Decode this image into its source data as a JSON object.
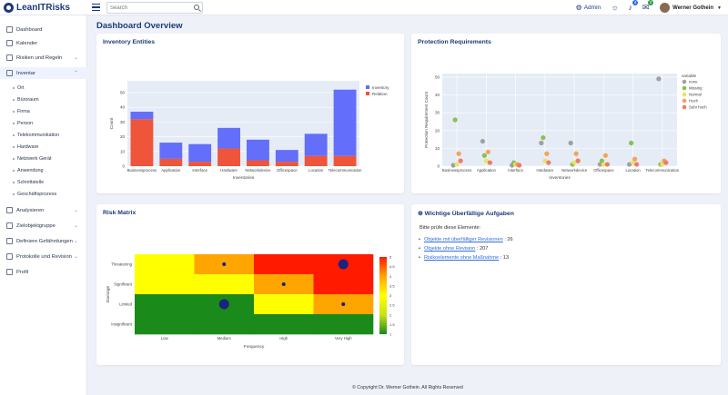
{
  "app": {
    "title": "LeanITRisks"
  },
  "search": {
    "placeholder": "Search"
  },
  "topbar": {
    "admin_label": "Admin",
    "notifications_count": "4",
    "messages_count": "2",
    "user_name": "Werner Gothein"
  },
  "sidebar": {
    "items": [
      {
        "label": "Dashboard",
        "icon": "dashboard-icon",
        "has_children": false
      },
      {
        "label": "Kalender",
        "icon": "calendar-icon",
        "has_children": false
      },
      {
        "label": "Risiken und Regeln",
        "icon": "risk-icon",
        "has_children": true
      },
      {
        "label": "Inventar",
        "icon": "inventory-icon",
        "has_children": true,
        "expanded": true
      },
      {
        "label": "Analysieren",
        "icon": "analyze-icon",
        "has_children": true
      },
      {
        "label": "Zielobjektgruppe",
        "icon": "target-group-icon",
        "has_children": true
      },
      {
        "label": "Definiere Gefährdungen",
        "icon": "threat-icon",
        "has_children": true
      },
      {
        "label": "Protokolle und Revision",
        "icon": "log-icon",
        "has_children": true
      },
      {
        "label": "Profil",
        "icon": "profile-icon",
        "has_children": false
      }
    ],
    "inventar_children": [
      "Ort",
      "Büroraum",
      "Firma",
      "Person",
      "Telekommunikation",
      "Hardware",
      "Netzwerk Gerät",
      "Anwendung",
      "Schnittstelle",
      "Geschäftsprozess"
    ]
  },
  "main": {
    "title": "Dashboard Overview"
  },
  "cards": {
    "inventory": {
      "title": "Inventory Entities"
    },
    "protection": {
      "title": "Protection Requirements"
    },
    "risk": {
      "title": "Risk Matrix"
    },
    "tasks": {
      "title": "Wichtige Überfällige Aufgaben",
      "intro": "Bitte prüfe diese Elemente:",
      "items": [
        {
          "link": "Objekte mit überfälliger Revisionen",
          "value": ": 26"
        },
        {
          "link": "Objekte ohne Revision",
          "value": ": 207"
        },
        {
          "link": "Risikoelemente ohne Maßnahme",
          "value": ": 13"
        }
      ]
    }
  },
  "chart_data": [
    {
      "type": "bar",
      "title": "",
      "xlabel": "Inventories",
      "ylabel": "Count",
      "categories": [
        "Businessprocess",
        "Application",
        "Interface",
        "Hardware",
        "Networkdevice",
        "Officespace",
        "Location",
        "Telecommunication"
      ],
      "series": [
        {
          "name": "Inventory",
          "color": "#636efa",
          "values": [
            5,
            11,
            12,
            14,
            14,
            8,
            15,
            45
          ]
        },
        {
          "name": "Relation",
          "color": "#ef553b",
          "values": [
            32,
            5,
            3,
            12,
            4,
            3,
            7,
            7
          ]
        }
      ],
      "stacked": true,
      "yticks": [
        0,
        10,
        20,
        30,
        40,
        50
      ],
      "ylim": [
        0,
        58
      ],
      "legend": "top-right"
    },
    {
      "type": "scatter",
      "title": "",
      "xlabel": "Inventories",
      "ylabel": "Protection Requirement Count",
      "categories": [
        "Businessprocess",
        "Application",
        "Interface",
        "Hardware",
        "Networkdevice",
        "Officespace",
        "Location",
        "Telecommunication"
      ],
      "yticks": [
        0,
        10,
        20,
        30,
        40,
        50
      ],
      "ylim": [
        0,
        52
      ],
      "legend_title": "variable",
      "legend": "right",
      "series": [
        {
          "name": "none",
          "color": "#a0a0a0",
          "points": [
            [
              0,
              0.5
            ],
            [
              1,
              14
            ],
            [
              2,
              0.5
            ],
            [
              3,
              13
            ],
            [
              4,
              13
            ],
            [
              5,
              1
            ],
            [
              6,
              1
            ],
            [
              7,
              49
            ]
          ]
        },
        {
          "name": "Missing",
          "color": "#88c057",
          "points": [
            [
              0,
              26
            ],
            [
              1,
              6
            ],
            [
              2,
              2
            ],
            [
              3,
              16
            ],
            [
              4,
              1
            ],
            [
              5,
              3
            ],
            [
              6,
              13
            ],
            [
              7,
              1
            ]
          ]
        },
        {
          "name": "Normal",
          "color": "#ece462",
          "points": [
            [
              0,
              1
            ],
            [
              1,
              3
            ],
            [
              2,
              1
            ],
            [
              3,
              3
            ],
            [
              4,
              2
            ],
            [
              5,
              1
            ],
            [
              6,
              2
            ],
            [
              7,
              1
            ]
          ]
        },
        {
          "name": "Hoch",
          "color": "#f4a35a",
          "points": [
            [
              0,
              7
            ],
            [
              1,
              8
            ],
            [
              2,
              1
            ],
            [
              3,
              7
            ],
            [
              4,
              7
            ],
            [
              5,
              6
            ],
            [
              6,
              4
            ],
            [
              7,
              3
            ]
          ]
        },
        {
          "name": "Sehr hoch",
          "color": "#f07b6b",
          "points": [
            [
              0,
              3
            ],
            [
              1,
              2
            ],
            [
              2,
              0.5
            ],
            [
              3,
              2
            ],
            [
              4,
              3
            ],
            [
              5,
              1
            ],
            [
              6,
              1
            ],
            [
              7,
              2
            ]
          ]
        }
      ]
    },
    {
      "type": "heatmap",
      "title": "",
      "xlabel": "Frequency",
      "ylabel": "Damage",
      "x_categories": [
        "Low",
        "Medium",
        "High",
        "Very High"
      ],
      "y_categories": [
        "Threatening",
        "Significant",
        "Limited",
        "Insignificant"
      ],
      "values": [
        [
          2,
          3,
          4,
          4
        ],
        [
          2,
          2,
          3,
          4
        ],
        [
          1,
          1,
          2,
          3
        ],
        [
          1,
          1,
          1,
          1
        ]
      ],
      "colorscale": [
        "#1a8a1a",
        "#c7e315",
        "#ffff00",
        "#ffa500",
        "#ff1a00"
      ],
      "colorbar_ticks": [
        1,
        1.5,
        2,
        2.5,
        3,
        3.5,
        4,
        4.5,
        5
      ],
      "markers": [
        {
          "x": 1,
          "y": 0,
          "size": 1
        },
        {
          "x": 3,
          "y": 0,
          "size": 3
        },
        {
          "x": 2,
          "y": 1,
          "size": 1
        },
        {
          "x": 1,
          "y": 2,
          "size": 3
        },
        {
          "x": 3,
          "y": 2,
          "size": 1
        }
      ]
    }
  ],
  "footer": {
    "text": "© Copyright Dr. Werner Gothein. All Rights Reserved"
  }
}
